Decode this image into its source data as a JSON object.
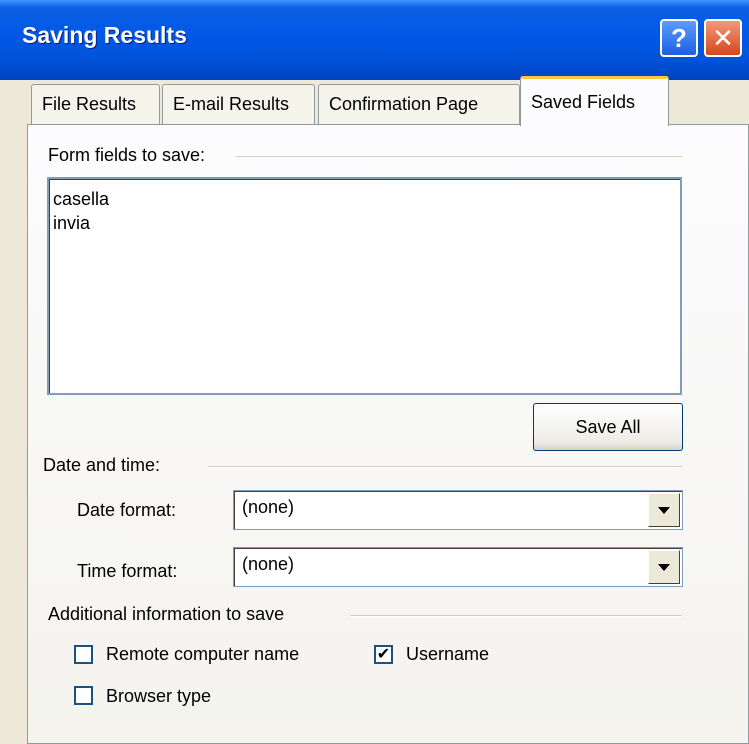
{
  "window": {
    "title": "Saving Results",
    "help_glyph": "?",
    "close_glyph": "✕"
  },
  "tabs": [
    {
      "label": "File Results",
      "active": false
    },
    {
      "label": "E-mail Results",
      "active": false
    },
    {
      "label": "Confirmation Page",
      "active": false
    },
    {
      "label": "Saved Fields",
      "active": true
    }
  ],
  "form_fields": {
    "group_label": "Form fields to save:",
    "items": [
      "casella",
      "invia"
    ],
    "save_all_label": "Save All"
  },
  "date_time": {
    "group_label": "Date and time:",
    "date_format_label": "Date format:",
    "date_format_value": "(none)",
    "time_format_label": "Time format:",
    "time_format_value": "(none)"
  },
  "additional": {
    "group_label": "Additional information to save",
    "remote_computer_label": "Remote computer name",
    "remote_computer_checked": false,
    "username_label": "Username",
    "username_checked": true,
    "browser_type_label": "Browser type",
    "browser_type_checked": false,
    "check_glyph": "✔"
  }
}
